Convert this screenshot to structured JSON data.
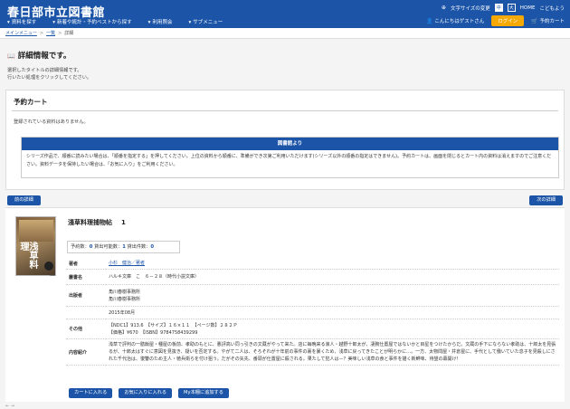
{
  "header": {
    "site_title": "春日部市立図書館",
    "nav": [
      "資料を探す",
      "新着や統計・予約ベストから探す",
      "利用照会",
      "サブメニュー"
    ],
    "font_size_label": "文字サイズの変更",
    "font_sizes": [
      "中",
      "大"
    ],
    "home": "HOME",
    "kids": "こどもよう",
    "greeting": "こんにちはゲストさん",
    "login": "ログイン",
    "cart": "予約カート"
  },
  "breadcrumb": [
    "メインメニュー",
    "一覧",
    "詳細"
  ],
  "page": {
    "title": "詳細情報です。",
    "instructions": [
      "選択したタイトルの詳細情報です。",
      "行いたい処理をクリックしてください。"
    ]
  },
  "cart": {
    "title": "予約カート",
    "empty_msg": "登録されている資料はありません。",
    "notice_title": "図書館より",
    "notice_text": "シリーズ作品で、順番に読みたい場合は、「順番を指定する」を押してください。上位の資料から順番に、準備ができ次第ご利用いただけます(シリーズ以外の順番の指定はできません)。予約カートは、画面を閉じるとカート内の資料は消えますのでご注意ください。資料データを保持したい場合は、「お気に入り」をご利用ください。"
  },
  "nav_buttons": {
    "prev": "前の詳細",
    "next": "次の詳細"
  },
  "book": {
    "cover_text": "浅草料理",
    "title": "淺草料理捕物帖",
    "volume": "1",
    "counts": {
      "reservations_label": "予約数：",
      "reservations": "0",
      "available_label": "貸出可能数：",
      "available": "1",
      "loans_label": "貸出件数：",
      "loans": "0"
    },
    "fields": [
      {
        "label": "著者",
        "value": "小杉　健治／著者",
        "link": true
      },
      {
        "label": "叢書名",
        "value": "ハルキ文庫　こ　６－２８（時代小説文庫）"
      },
      {
        "label": "出版者",
        "value": "角川春樹事務所\n角川春樹事務所"
      },
      {
        "label": "",
        "value": "2015年08月"
      },
      {
        "label": "その他",
        "value": "【NDC1】913.6　【サイズ】１６×１１　【ページ数】２８２Ｐ\n【価格】¥670　【ISBN】9784758439299"
      },
      {
        "label": "内容紹介",
        "value": "浅草で評判の一膳飯屋・種屋の板前、孝助のもとに、悪評高い同っ引きの文蔵がやって来た。店に毎晩来る浪人・越野十郎太が、凄腕仕置屋ではないかと目星をつけたからだ。文蔵の手下にならない孝助は、十郎太を見張るが、十郎太はすぐに意図を見抜き、疑いを否定する。やがて二人は、そろそれが十年前の事件の裏を暴くため、浅草に戻ってきたことが明らかに…。一方、太物問屋・井倉屋に、手代として働いていた息子を見殺しにされた千代治は、復讐のため主人・徳兵衛らを付け狙う。だがその矢先、番頭が仕置屋に殺される。果たして犯人は－？美味しい浅草の食と事件を描く新鮮味、待望の幕開け！"
      }
    ],
    "actions": [
      "カートに入れる",
      "お気に入りに入れる",
      "My本棚に追加する"
    ]
  },
  "colors": {
    "primary": "#1c55a8",
    "accent": "#f5a800"
  }
}
